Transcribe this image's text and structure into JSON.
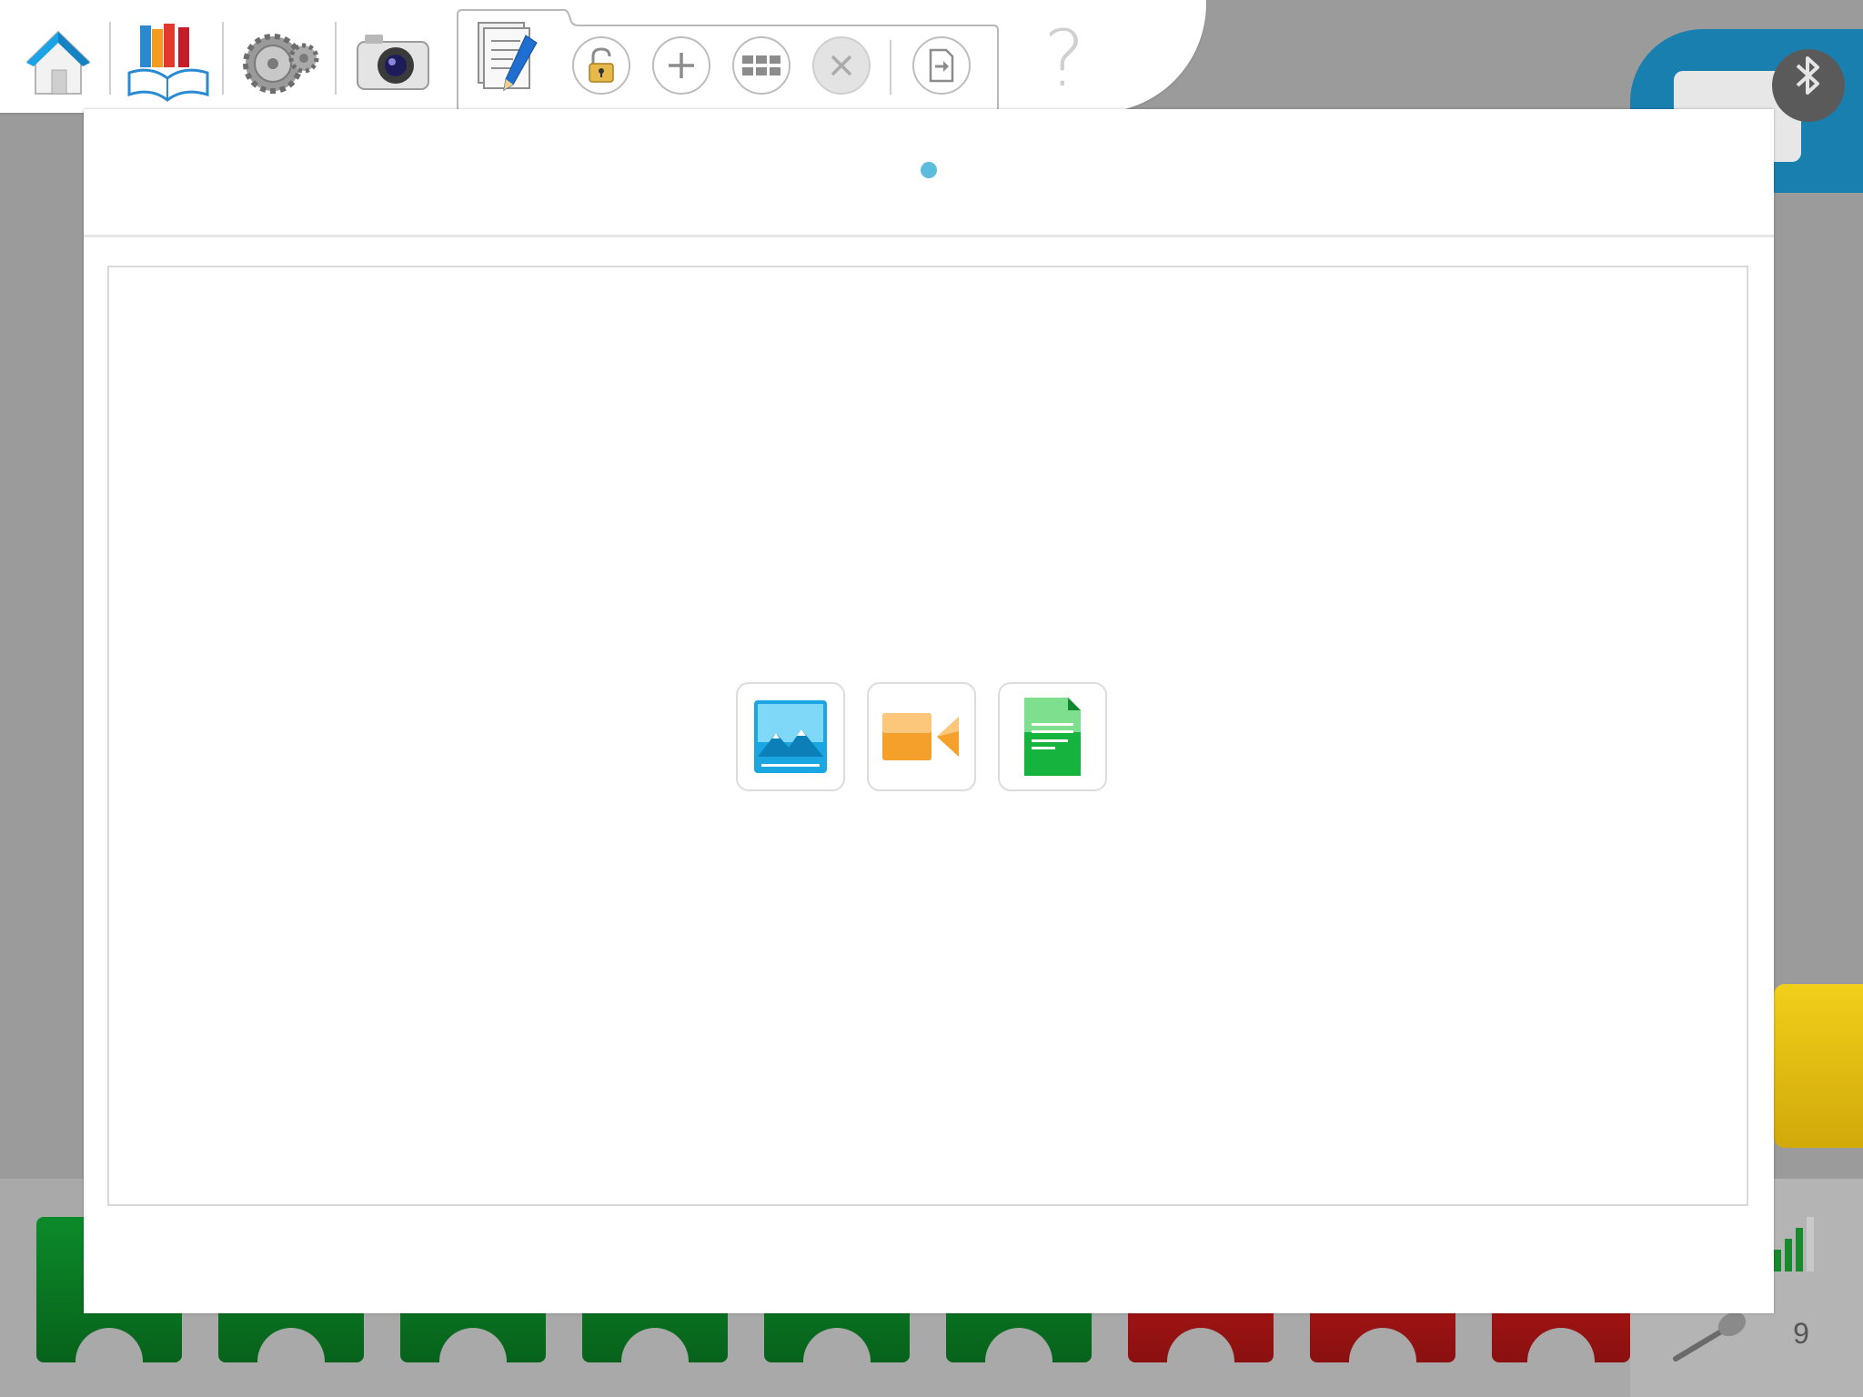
{
  "toolbar": {
    "nav": [
      "home-icon",
      "library-icon",
      "gears-icon",
      "camera-icon"
    ],
    "documentation_tab": "documentation-icon",
    "doc_actions": [
      "lock-icon",
      "add-icon",
      "grid-icon",
      "close-icon",
      "export-icon"
    ],
    "help_label": "?"
  },
  "hub": {
    "bluetooth_icon": "bluetooth-icon",
    "accent": "#197fae"
  },
  "documentation": {
    "page_indicator_color": "#5bbcdc",
    "media_options": [
      {
        "name": "image",
        "icon": "image-icon",
        "color": "#1aa6e0"
      },
      {
        "name": "video",
        "icon": "video-icon",
        "color": "#f5a02a"
      },
      {
        "name": "text",
        "icon": "text-document-icon",
        "color": "#17b33f"
      }
    ]
  },
  "footer": {
    "page_number": "9"
  }
}
